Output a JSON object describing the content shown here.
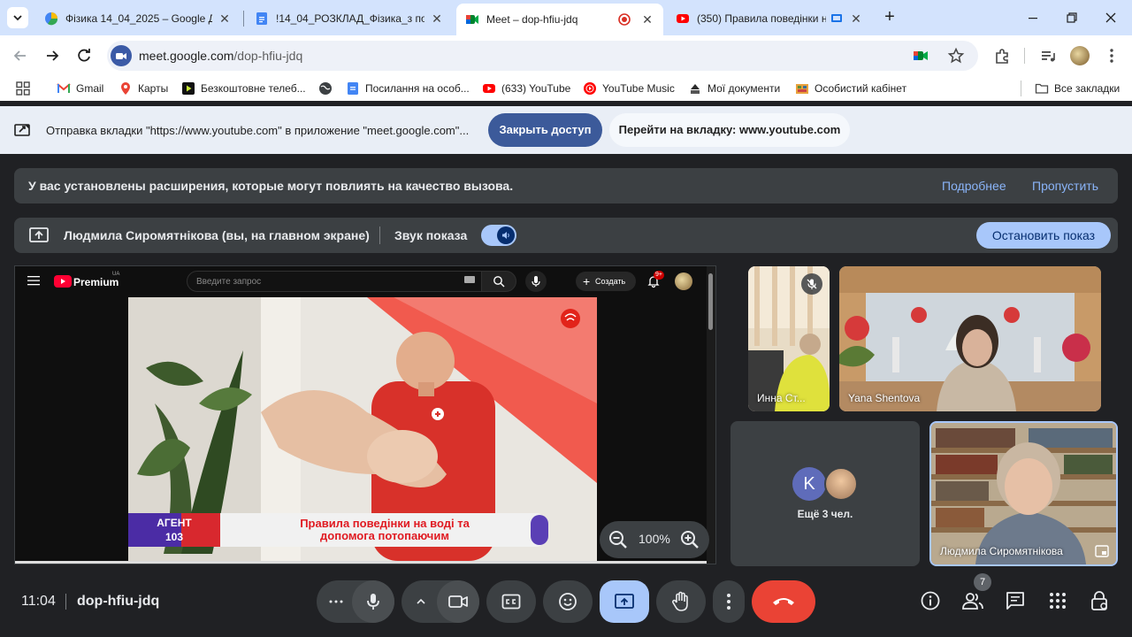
{
  "browser": {
    "tabs": [
      {
        "title": "Фізика 14_04_2025 – Google Д"
      },
      {
        "title": "!14_04_РОЗКЛАД_Фізика_з пос"
      },
      {
        "title": "Meet – dop-hfiu-jdq"
      },
      {
        "title": "(350) Правила поведінки н"
      }
    ],
    "url_host": "meet.google.com",
    "url_path": "/dop-hfiu-jdq",
    "bookmarks": [
      {
        "label": "Gmail"
      },
      {
        "label": "Карты"
      },
      {
        "label": "Безкоштовне телеб..."
      },
      {
        "label": "Посилання на особ..."
      },
      {
        "label": "(633) YouTube"
      },
      {
        "label": "YouTube Music"
      },
      {
        "label": "Мої документи"
      },
      {
        "label": "Особистий кабінет"
      }
    ],
    "all_bookmarks": "Все закладки",
    "infobar": {
      "text": "Отправка вкладки \"https://www.youtube.com\" в приложение \"meet.google.com\"...",
      "stop_sharing": "Закрыть доступ",
      "goto_tab": "Перейти на вкладку: www.youtube.com"
    }
  },
  "meet": {
    "extensions_banner": {
      "message": "У вас установлены расширения, которые могут повлиять на качество вызова.",
      "more": "Подробнее",
      "skip": "Пропустить"
    },
    "presenting_bar": {
      "presenter": "Людмила Сиромятнікова (вы, на главном экране)",
      "sound_label": "Звук показа",
      "stop_label": "Остановить показ"
    },
    "shared_screen": {
      "brand": "Premium",
      "region": "UA",
      "search_placeholder": "Введите запрос",
      "create_label": "Создать",
      "notif_badge": "9+",
      "lower_third_left_line1": "АГЕНТ",
      "lower_third_left_line2": "103",
      "lower_third_title_line1": "Правила поведінки на воді та",
      "lower_third_title_line2": "допомога потопаючим",
      "zoom": "100%"
    },
    "participants": [
      {
        "name": "Инна Ст..."
      },
      {
        "name": "Yana Shentova"
      },
      {
        "name": "Людмила Сиромятнікова"
      }
    ],
    "others": {
      "initial": "K",
      "label": "Ещё 3 чел."
    },
    "controls": {
      "time": "11:04",
      "meeting_code": "dop-hfiu-jdq",
      "people_count": "7"
    }
  },
  "colors": {
    "meet_bg": "#202124",
    "accent_blue": "#a8c7fa",
    "end_call_red": "#ea4335",
    "present_active": "#a8c7fa"
  }
}
